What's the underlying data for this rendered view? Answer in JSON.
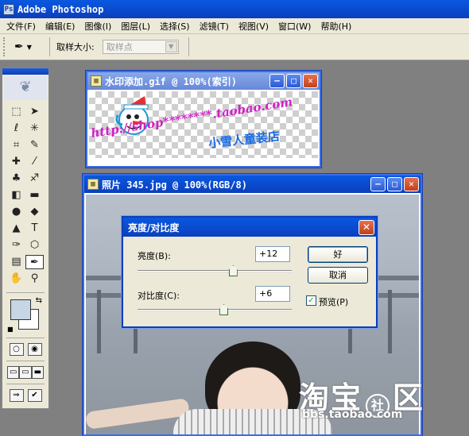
{
  "app": {
    "title": "Adobe Photoshop",
    "icon": "photoshop-icon"
  },
  "menu": [
    "文件(F)",
    "编辑(E)",
    "图像(I)",
    "图层(L)",
    "选择(S)",
    "滤镜(T)",
    "视图(V)",
    "窗口(W)",
    "帮助(H)"
  ],
  "options": {
    "tool_icon": "eyedropper-icon",
    "sample_size_label": "取样大小:",
    "sample_size_value": "取样点"
  },
  "toolbox": {
    "tools": [
      "marquee-icon",
      "move-icon",
      "lasso-icon",
      "magic-wand-icon",
      "crop-icon",
      "slice-icon",
      "healing-icon",
      "brush-icon",
      "stamp-icon",
      "history-brush-icon",
      "eraser-icon",
      "gradient-icon",
      "blur-icon",
      "dodge-icon",
      "path-select-icon",
      "type-icon",
      "pen-icon",
      "shape-icon",
      "notes-icon",
      "eyedropper-icon",
      "hand-icon",
      "zoom-icon"
    ],
    "active_tool": "eyedropper-icon",
    "foreground_color": "#c7d6e4",
    "background_color": "#ffffff"
  },
  "watermark_window": {
    "title": "水印添加.gif @ 100%(索引)",
    "text_url": "http://shop********.taobao.com",
    "text_cn": "小雪人童装店"
  },
  "photo_window": {
    "title": "照片 345.jpg @ 100%(RGB/8)"
  },
  "dialog": {
    "title": "亮度/对比度",
    "brightness_label": "亮度(B):",
    "brightness_value": "+12",
    "brightness_level": 0.62,
    "contrast_label": "对比度(C):",
    "contrast_value": "+6",
    "contrast_level": 0.56,
    "ok_label": "好",
    "cancel_label": "取消",
    "preview_label": "预览(P)",
    "preview_checked": true
  },
  "site_watermark": {
    "brand": "淘宝",
    "badge_1": "社",
    "badge_2": "区",
    "url": "bbs.taobao.com"
  }
}
